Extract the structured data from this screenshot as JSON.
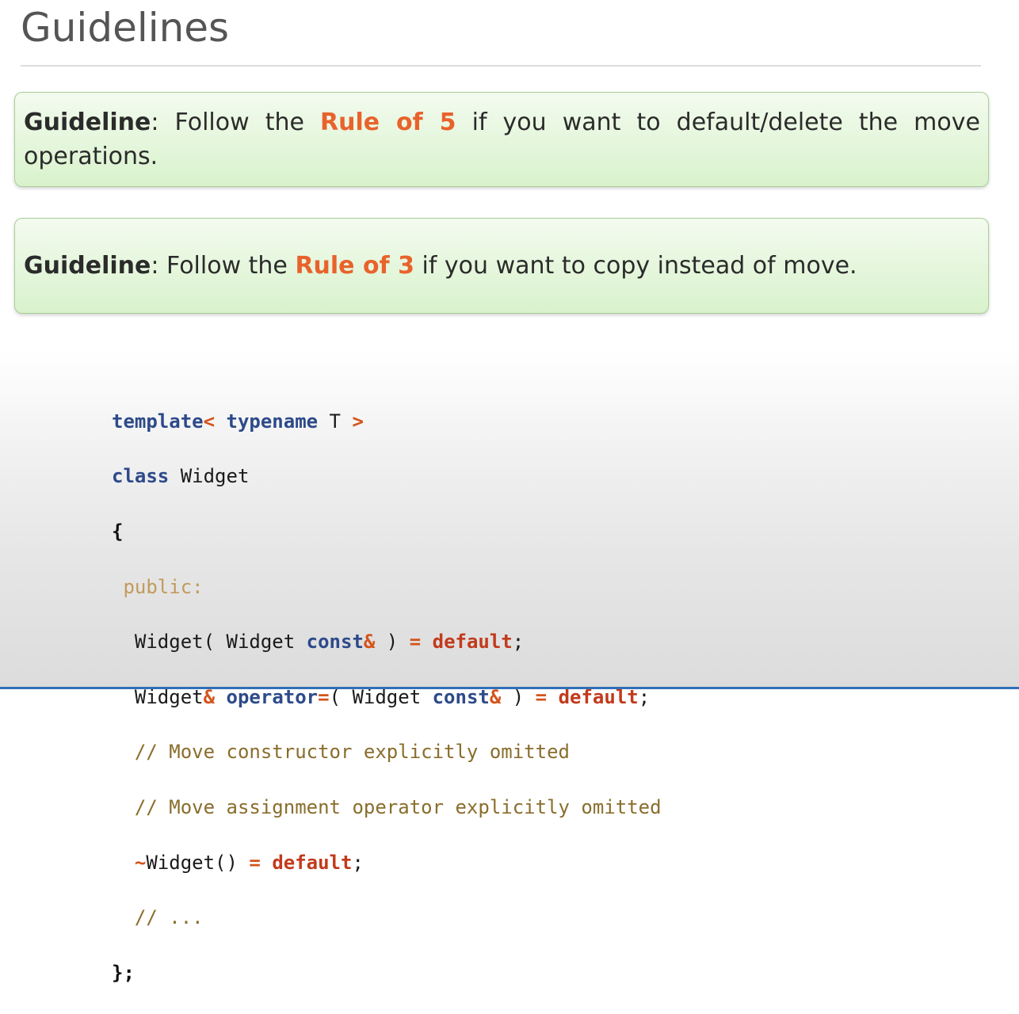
{
  "slide": {
    "title": "Guidelines"
  },
  "guidelines": [
    {
      "label": "Guideline",
      "sep": ": ",
      "before": "Follow the ",
      "highlight": "Rule of 5",
      "after": " if you want to default/delete the move operations."
    },
    {
      "label": "Guideline",
      "sep": ": ",
      "before": "Follow the ",
      "highlight": "Rule of 3",
      "after": " if you want to copy instead of move."
    }
  ],
  "code": {
    "l1": {
      "kw1": "template",
      "op1": "<",
      "sp1": " ",
      "kw2": "typename",
      "txt": " T ",
      "op2": ">"
    },
    "l2": {
      "kw": "class",
      "txt": " Widget"
    },
    "l3": {
      "brace": "{"
    },
    "l4": {
      "indent": " ",
      "access": "public:"
    },
    "l5": {
      "indent": "  ",
      "t1": "Widget( Widget ",
      "kw": "const",
      "op1": "&",
      "t2": " ) ",
      "op2": "=",
      "sp": " ",
      "dft": "default",
      "semi": ";"
    },
    "l6": {
      "indent": "  ",
      "t1": "Widget",
      "op1": "&",
      "sp1": " ",
      "kw1": "operator",
      "op2": "=",
      "t2": "( Widget ",
      "kw2": "const",
      "op3": "&",
      "t3": " ) ",
      "op4": "=",
      "sp2": " ",
      "dft": "default",
      "semi": ";"
    },
    "l7": {
      "indent": "  ",
      "comment": "// Move constructor explicitly omitted"
    },
    "l8": {
      "indent": "  ",
      "comment": "// Move assignment operator explicitly omitted"
    },
    "l9": {
      "indent": "  ",
      "op1": "~",
      "t1": "Widget() ",
      "op2": "=",
      "sp": " ",
      "dft": "default",
      "semi": ";"
    },
    "l10": {
      "indent": "  ",
      "comment": "// ..."
    },
    "l11": {
      "brace": "};"
    }
  },
  "colors": {
    "box_border": "#a9cf98",
    "box_fill_top": "#f3fbef",
    "box_fill_bottom": "#d9f2cc",
    "highlight": "#e8632c",
    "keyword": "#2d4a8a",
    "operator": "#d4541c",
    "default_keyword": "#c23a1c",
    "comment": "#8a6d2c",
    "access_specifier": "#c39a5d"
  }
}
